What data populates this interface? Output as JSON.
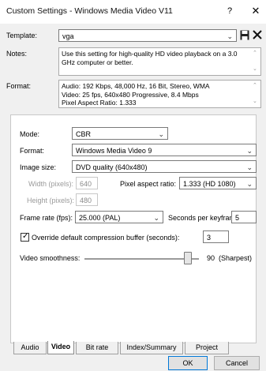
{
  "window": {
    "title": "Custom Settings - Windows Media Video V11",
    "help_label": "?",
    "close_label": "✕"
  },
  "template": {
    "label": "Template:",
    "value": "vga"
  },
  "notes": {
    "label": "Notes:",
    "text": "Use this setting for high-quality HD video playback on a 3.0 GHz computer or better."
  },
  "format_info": {
    "label": "Format:",
    "line1": "Audio: 192 Kbps, 48,000 Hz, 16 Bit, Stereo, WMA",
    "line2": "Video: 25 fps, 640x480 Progressive, 8.4 Mbps",
    "line3": "Pixel Aspect Ratio: 1.333"
  },
  "video": {
    "mode_label": "Mode:",
    "mode_value": "CBR",
    "format_label": "Format:",
    "format_value": "Windows Media Video 9",
    "image_size_label": "Image size:",
    "image_size_value": "DVD quality (640x480)",
    "width_label": "Width (pixels):",
    "width_value": "640",
    "height_label": "Height (pixels):",
    "height_value": "480",
    "par_label": "Pixel aspect ratio:",
    "par_value": "1.333 (HD 1080)",
    "frame_rate_label": "Frame rate (fps):",
    "frame_rate_value": "25.000 (PAL)",
    "keyframe_label": "Seconds per keyframe:",
    "keyframe_value": "5",
    "override_label": "Override default compression buffer (seconds):",
    "override_checked": true,
    "buffer_value": "3",
    "smoothness_label": "Video smoothness:",
    "smoothness_value": 90,
    "smoothness_max": 100,
    "smoothness_display": "90",
    "smoothness_suffix": "(Sharpest)"
  },
  "tabs": [
    {
      "label": "Audio",
      "active": false
    },
    {
      "label": "Video",
      "active": true
    },
    {
      "label": "Bit rate",
      "active": false
    },
    {
      "label": "Index/Summary",
      "active": false
    },
    {
      "label": "Project",
      "active": false
    }
  ],
  "buttons": {
    "ok": "OK",
    "cancel": "Cancel"
  },
  "icons": {
    "save": "save-icon",
    "delete": "delete-icon"
  }
}
